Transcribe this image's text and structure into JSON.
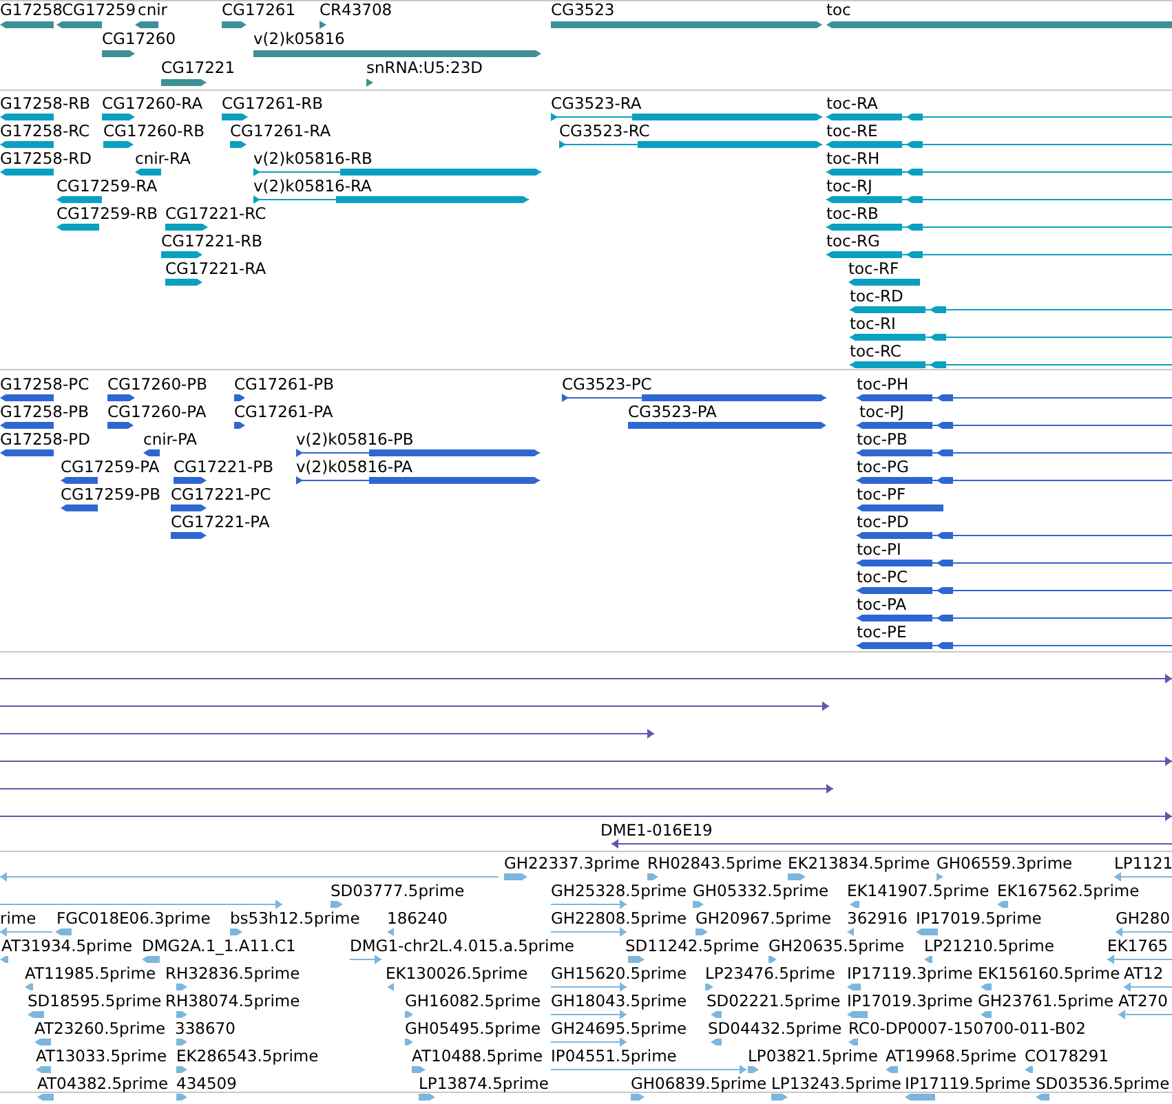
{
  "tracks": [
    {
      "color": "#3f9096",
      "features": [
        {
          "label": "G17258",
          "reverse": true
        },
        {
          "label": "CG17259",
          "reverse": true
        },
        {
          "label": "cnir",
          "reverse": true
        },
        {
          "label": "CG17261",
          "reverse": false
        },
        {
          "label": "CR43708",
          "reverse": false
        },
        {
          "label": "CG3523",
          "reverse": false
        },
        {
          "label": "toc",
          "reverse": true
        },
        {
          "label": "CG17260",
          "reverse": false
        },
        {
          "label": "v(2)k05816",
          "reverse": false
        },
        {
          "label": "CG17221",
          "reverse": false
        },
        {
          "label": "snRNA:U5:23D",
          "reverse": false
        }
      ]
    },
    {
      "color": "#0aa0c0",
      "features": [
        {
          "label": "G17258-RB",
          "reverse": true
        },
        {
          "label": "CG17260-RA",
          "reverse": false
        },
        {
          "label": "CG17261-RB",
          "reverse": false
        },
        {
          "label": "CG3523-RA",
          "reverse": false
        },
        {
          "label": "toc-RA",
          "reverse": true
        },
        {
          "label": "G17258-RC",
          "reverse": true
        },
        {
          "label": "CG17260-RB",
          "reverse": false
        },
        {
          "label": "CG17261-RA",
          "reverse": false
        },
        {
          "label": "CG3523-RC",
          "reverse": false
        },
        {
          "label": "toc-RE",
          "reverse": true
        },
        {
          "label": "G17258-RD",
          "reverse": true
        },
        {
          "label": "cnir-RA",
          "reverse": true
        },
        {
          "label": "v(2)k05816-RB",
          "reverse": false
        },
        {
          "label": "toc-RH",
          "reverse": true
        },
        {
          "label": "CG17259-RA",
          "reverse": true
        },
        {
          "label": "v(2)k05816-RA",
          "reverse": false
        },
        {
          "label": "toc-RJ",
          "reverse": true
        },
        {
          "label": "CG17259-RB",
          "reverse": true
        },
        {
          "label": "CG17221-RC",
          "reverse": false
        },
        {
          "label": "toc-RB",
          "reverse": true
        },
        {
          "label": "CG17221-RB",
          "reverse": false
        },
        {
          "label": "toc-RG",
          "reverse": true
        },
        {
          "label": "CG17221-RA",
          "reverse": false
        },
        {
          "label": "toc-RF",
          "reverse": true
        },
        {
          "label": "toc-RD",
          "reverse": true
        },
        {
          "label": "toc-RI",
          "reverse": true
        },
        {
          "label": "toc-RC",
          "reverse": true
        }
      ]
    },
    {
      "color": "#2e67d2",
      "features": [
        {
          "label": "G17258-PC",
          "reverse": true
        },
        {
          "label": "CG17260-PB",
          "reverse": false
        },
        {
          "label": "CG17261-PB",
          "reverse": false
        },
        {
          "label": "CG3523-PC",
          "reverse": false
        },
        {
          "label": "toc-PH",
          "reverse": true
        },
        {
          "label": "G17258-PB",
          "reverse": true
        },
        {
          "label": "CG17260-PA",
          "reverse": false
        },
        {
          "label": "CG17261-PA",
          "reverse": false
        },
        {
          "label": "CG3523-PA",
          "reverse": false
        },
        {
          "label": "toc-PJ",
          "reverse": true
        },
        {
          "label": "G17258-PD",
          "reverse": true
        },
        {
          "label": "cnir-PA",
          "reverse": true
        },
        {
          "label": "v(2)k05816-PB",
          "reverse": false
        },
        {
          "label": "toc-PB",
          "reverse": true
        },
        {
          "label": "CG17259-PA",
          "reverse": true
        },
        {
          "label": "CG17221-PB",
          "reverse": false
        },
        {
          "label": "v(2)k05816-PA",
          "reverse": false
        },
        {
          "label": "toc-PG",
          "reverse": true
        },
        {
          "label": "CG17259-PB",
          "reverse": true
        },
        {
          "label": "CG17221-PC",
          "reverse": false
        },
        {
          "label": "toc-PF",
          "reverse": true
        },
        {
          "label": "CG17221-PA",
          "reverse": false
        },
        {
          "label": "toc-PD",
          "reverse": true
        },
        {
          "label": "toc-PI",
          "reverse": true
        },
        {
          "label": "toc-PC",
          "reverse": true
        },
        {
          "label": "toc-PA",
          "reverse": true
        },
        {
          "label": "toc-PE",
          "reverse": true
        }
      ]
    },
    {
      "color": "#6a52b0",
      "features": [
        {
          "reverse": false
        },
        {
          "reverse": false
        },
        {
          "reverse": false
        },
        {
          "reverse": false
        },
        {
          "reverse": false
        },
        {
          "reverse": false
        },
        {
          "label": "DME1-016E19",
          "reverse": true
        }
      ]
    },
    {
      "color": "#7db6dd",
      "features": [
        {
          "reverse": true
        },
        {
          "label": "GH22337.3prime",
          "reverse": false
        },
        {
          "label": "RH02843.5prime",
          "reverse": false
        },
        {
          "label": "EK213834.5prime",
          "reverse": false
        },
        {
          "label": "GH06559.3prime",
          "reverse": false
        },
        {
          "label": "LP1121",
          "reverse": true
        },
        {
          "reverse": false
        },
        {
          "label": "SD03777.5prime",
          "reverse": false
        },
        {
          "label": "GH25328.5prime",
          "reverse": false
        },
        {
          "label": "GH05332.5prime",
          "reverse": false
        },
        {
          "label": "EK141907.5prime",
          "reverse": true
        },
        {
          "label": "EK167562.5prime",
          "reverse": true
        },
        {
          "label": "rime",
          "reverse": true
        },
        {
          "label": "FGC018E06.3prime",
          "reverse": true
        },
        {
          "label": "bs53h12.5prime",
          "reverse": false
        },
        {
          "label": "186240",
          "reverse": true
        },
        {
          "label": "GH22808.5prime",
          "reverse": false
        },
        {
          "label": "GH20967.5prime",
          "reverse": false
        },
        {
          "label": "362916",
          "reverse": true
        },
        {
          "label": "IP17019.5prime",
          "reverse": true
        },
        {
          "label": "GH280",
          "reverse": true
        },
        {
          "label": "AT31934.5prime",
          "reverse": true
        },
        {
          "label": "DMG2A.1_1.A11.C1",
          "reverse": true
        },
        {
          "label": "DMG1-chr2L.4.015.a.5prime",
          "reverse": false
        },
        {
          "label": "SD11242.5prime",
          "reverse": false
        },
        {
          "label": "GH20635.5prime",
          "reverse": false
        },
        {
          "label": "LP21210.5prime",
          "reverse": true
        },
        {
          "label": "EK1765",
          "reverse": true
        },
        {
          "label": "AT11985.5prime",
          "reverse": true
        },
        {
          "label": "RH32836.5prime",
          "reverse": false
        },
        {
          "label": "EK130026.5prime",
          "reverse": true
        },
        {
          "label": "GH15620.5prime",
          "reverse": false
        },
        {
          "label": "LP23476.5prime",
          "reverse": false
        },
        {
          "label": "IP17119.3prime",
          "reverse": true
        },
        {
          "label": "EK156160.5prime",
          "reverse": true
        },
        {
          "label": "AT12",
          "reverse": true
        },
        {
          "label": "SD18595.5prime",
          "reverse": true
        },
        {
          "label": "RH38074.5prime",
          "reverse": false
        },
        {
          "label": "GH16082.5prime",
          "reverse": false
        },
        {
          "label": "GH18043.5prime",
          "reverse": false
        },
        {
          "label": "SD02221.5prime",
          "reverse": true
        },
        {
          "label": "IP17019.3prime",
          "reverse": true
        },
        {
          "label": "GH23761.5prime",
          "reverse": true
        },
        {
          "label": "AT270",
          "reverse": true
        },
        {
          "label": "AT23260.5prime",
          "reverse": true
        },
        {
          "label": "338670",
          "reverse": false
        },
        {
          "label": "GH05495.5prime",
          "reverse": false
        },
        {
          "label": "GH24695.5prime",
          "reverse": false
        },
        {
          "label": "SD04432.5prime",
          "reverse": true
        },
        {
          "label": "RC0-DP0007-150700-011-B02",
          "reverse": true
        },
        {
          "label": "AT13033.5prime",
          "reverse": true
        },
        {
          "label": "EK286543.5prime",
          "reverse": false
        },
        {
          "label": "AT10488.5prime",
          "reverse": false
        },
        {
          "label": "IP04551.5prime",
          "reverse": false
        },
        {
          "label": "LP03821.5prime",
          "reverse": false
        },
        {
          "label": "AT19968.5prime",
          "reverse": true
        },
        {
          "label": "CO178291",
          "reverse": true
        },
        {
          "label": "AT04382.5prime",
          "reverse": true
        },
        {
          "label": "434509",
          "reverse": false
        },
        {
          "label": "LP13874.5prime",
          "reverse": false
        },
        {
          "label": "GH06839.5prime",
          "reverse": false
        },
        {
          "label": "LP13243.5prime",
          "reverse": false
        },
        {
          "label": "IP17119.5prime",
          "reverse": true
        },
        {
          "label": "SD03536.5prime",
          "reverse": true
        }
      ]
    }
  ]
}
